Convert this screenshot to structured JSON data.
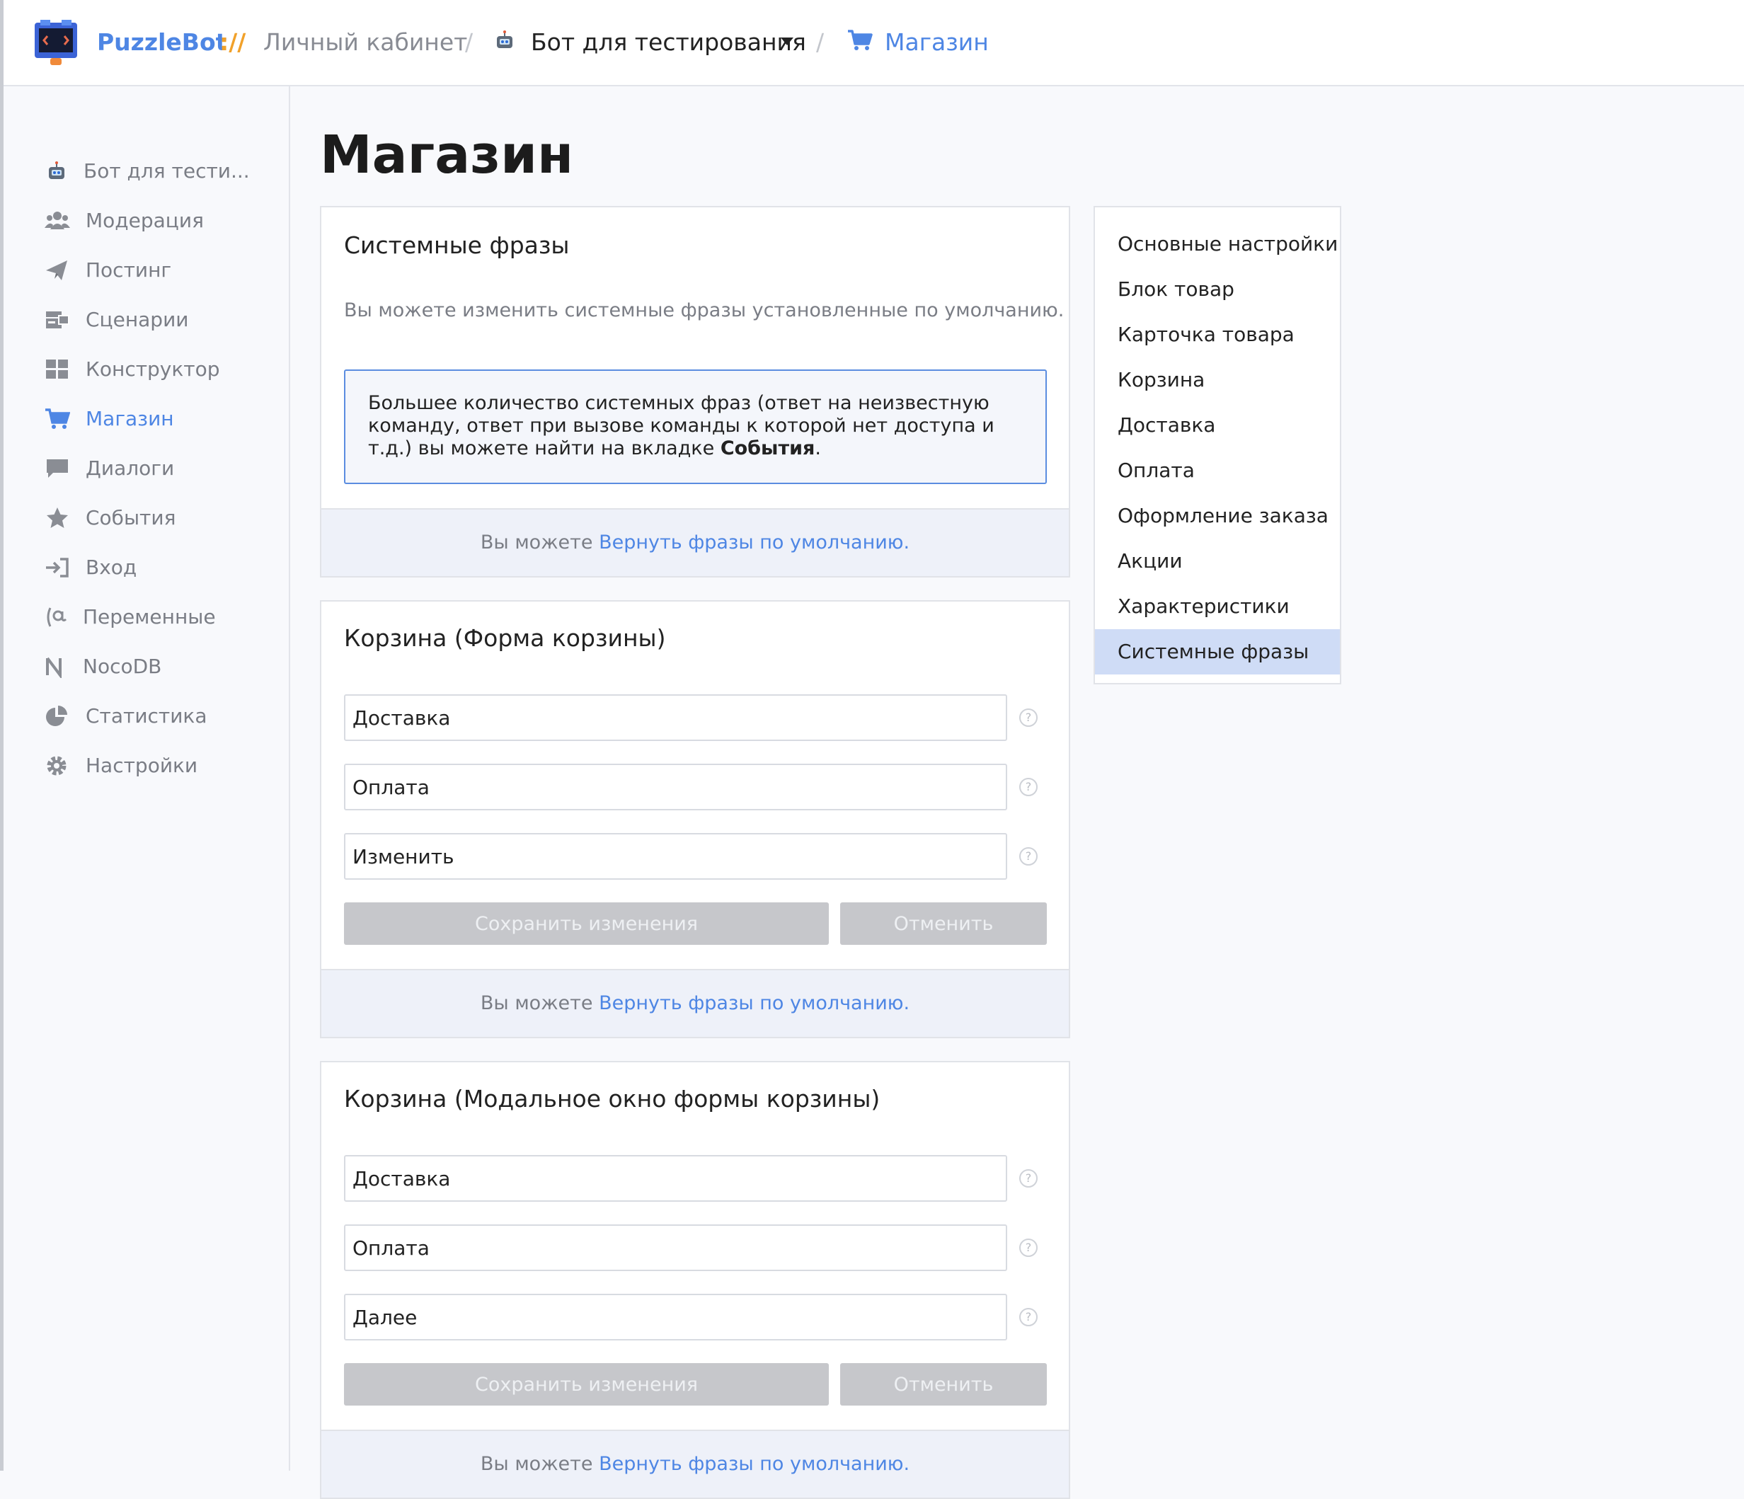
{
  "header": {
    "brand": "PuzzleBot",
    "brand_sep": "://",
    "crumb_cabinet": "Личный кабинет",
    "separator": "/",
    "crumb_bot": "Бот для тестирования",
    "crumb_section": "Магазин"
  },
  "sidebar": {
    "items": [
      {
        "label": "Бот для тести...",
        "icon": "bot-icon"
      },
      {
        "label": "Модерация",
        "icon": "users-icon"
      },
      {
        "label": "Постинг",
        "icon": "paper-plane-icon"
      },
      {
        "label": "Сценарии",
        "icon": "scenarios-icon"
      },
      {
        "label": "Конструктор",
        "icon": "grid-icon"
      },
      {
        "label": "Магазин",
        "icon": "cart-icon",
        "active": true
      },
      {
        "label": "Диалоги",
        "icon": "chat-icon"
      },
      {
        "label": "События",
        "icon": "star-icon"
      },
      {
        "label": "Вход",
        "icon": "sign-in-icon"
      },
      {
        "label": "Переменные",
        "icon": "variable-icon"
      },
      {
        "label": "NocoDB",
        "icon": "nocodb-icon"
      },
      {
        "label": "Статистика",
        "icon": "pie-chart-icon"
      },
      {
        "label": "Настройки",
        "icon": "gear-icon"
      }
    ]
  },
  "main": {
    "title": "Магазин",
    "system": {
      "title": "Системные фразы",
      "desc": "Вы можете изменить системные фразы установленные по умолчанию.",
      "note_text": "Большее количество системных фраз (ответ на неизвестную команду, ответ при вызове команды к которой нет доступа и т.д.) вы можете найти на вкладке ",
      "note_bold": "События",
      "note_end": ".",
      "footer_text": "Вы можете ",
      "footer_link": "Вернуть фразы по умолчанию."
    },
    "cart_form": {
      "title": "Корзина (Форма корзины)",
      "fields": [
        "Доставка",
        "Оплата",
        "Изменить"
      ],
      "save_label": "Сохранить изменения",
      "cancel_label": "Отменить",
      "footer_text": "Вы можете ",
      "footer_link": "Вернуть фразы по умолчанию."
    },
    "cart_modal": {
      "title": "Корзина (Модальное окно формы корзины)",
      "fields": [
        "Доставка",
        "Оплата",
        "Далее"
      ],
      "save_label": "Сохранить изменения",
      "cancel_label": "Отменить",
      "footer_text": "Вы можете ",
      "footer_link": "Вернуть фразы по умолчанию."
    },
    "help_mark": "?"
  },
  "right_nav": {
    "items": [
      {
        "label": "Основные настройки"
      },
      {
        "label": "Блок товар"
      },
      {
        "label": "Карточка товара"
      },
      {
        "label": "Корзина"
      },
      {
        "label": "Доставка"
      },
      {
        "label": "Оплата"
      },
      {
        "label": "Оформление заказа"
      },
      {
        "label": "Акции"
      },
      {
        "label": "Характеристики"
      },
      {
        "label": "Системные фразы",
        "active": true
      }
    ]
  },
  "colors": {
    "accent": "#4e86e4",
    "brand_sep": "#f1a12a",
    "active_bg": "#cfdcf6",
    "button_disabled": "#c6c7cb"
  }
}
